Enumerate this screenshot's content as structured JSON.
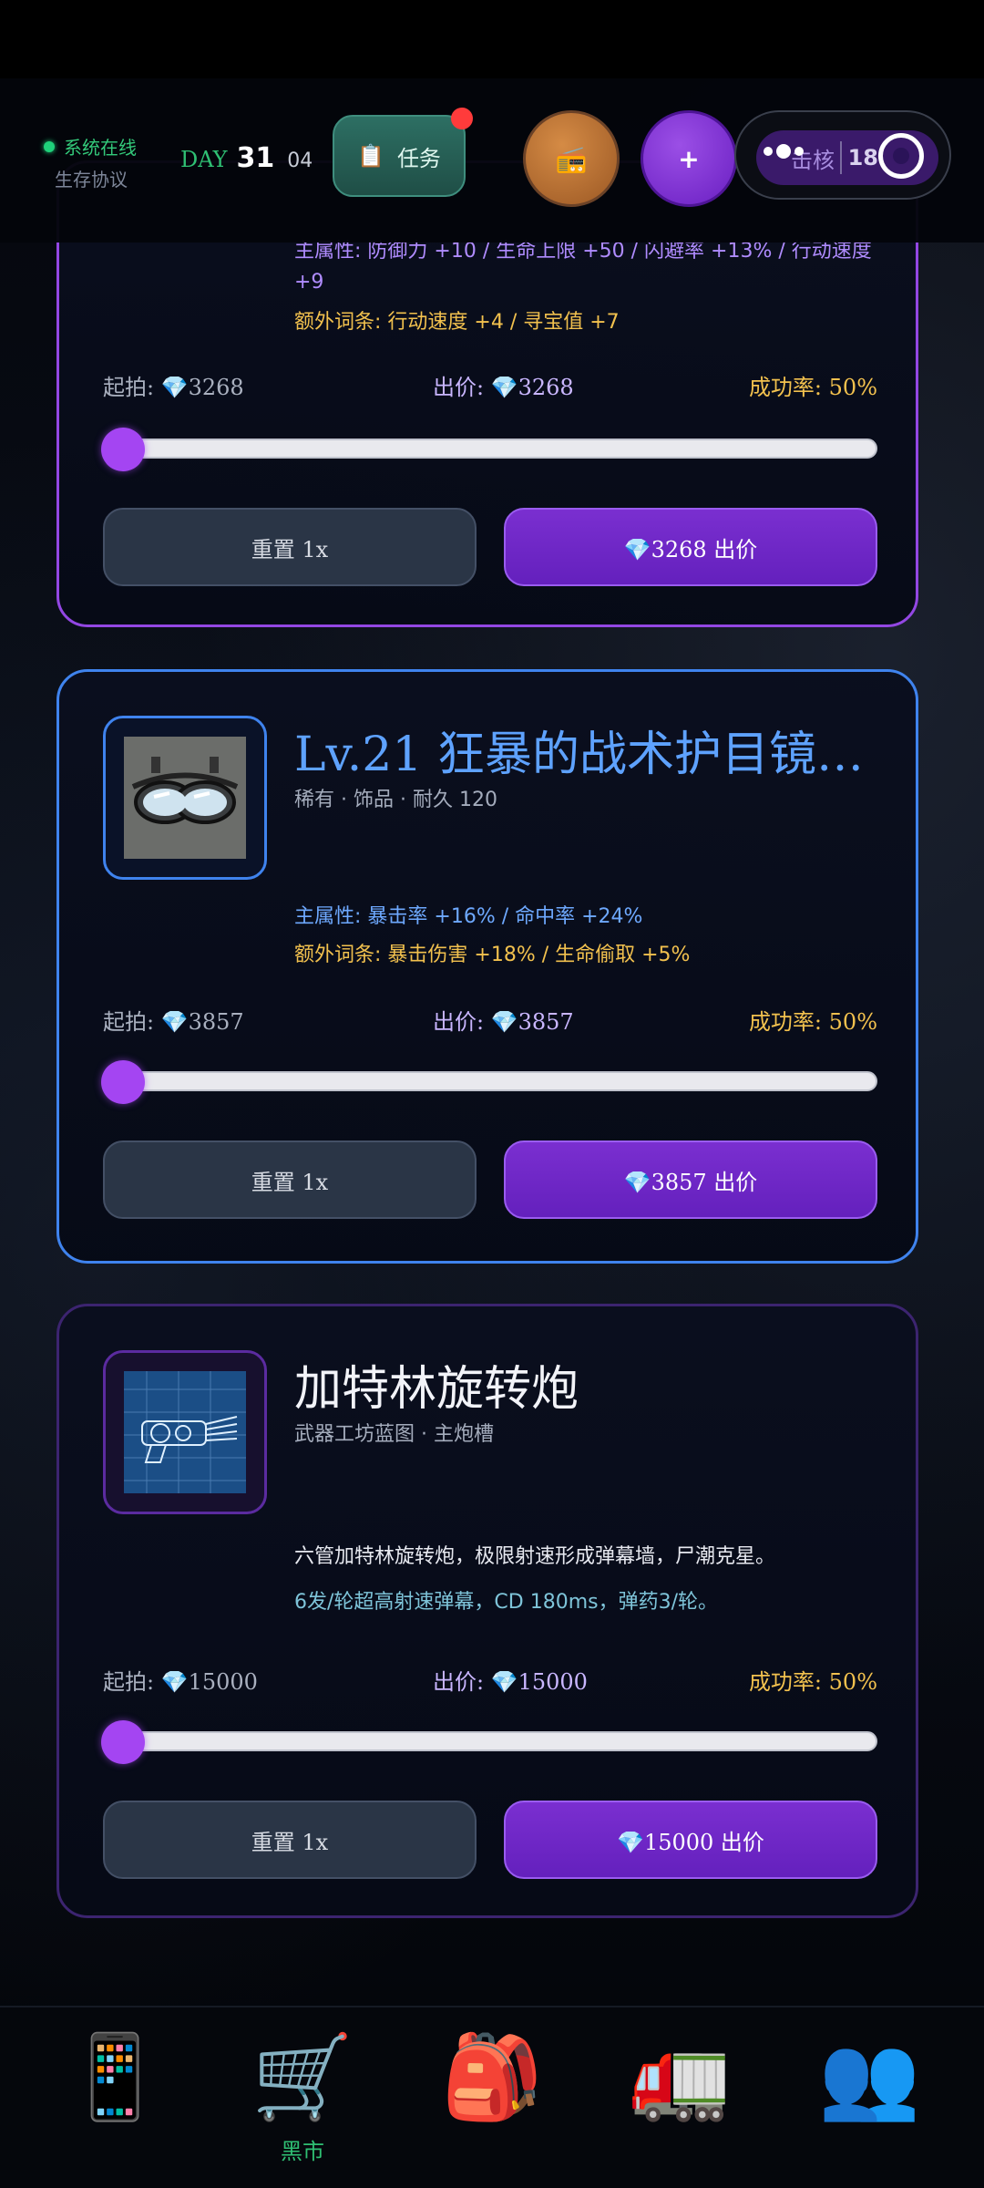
{
  "header": {
    "status_online": "系统在线",
    "status_protocol": "生存协议",
    "day_label": "DAY",
    "day_number": "31",
    "day_sub": "04",
    "task_label": "任务",
    "task_icon": "clipboard-icon",
    "radio_icon": "radio-icon",
    "plus_label": "+",
    "capsule_label": "击核",
    "capsule_number": "18"
  },
  "cards": [
    {
      "attr_main": "主属性: 防御力 +10 / 生命上限 +50 / 闪避率 +13% / 行动速度 +9",
      "attr_extra": "额外词条: 行动速度 +4 / 寻宝值 +7",
      "start_price": "起拍: 💎3268",
      "bid_price": "出价: 💎3268",
      "success_rate": "成功率: 50%",
      "slider_fraction": 0.0,
      "reset_label": "重置 1x",
      "bid_label": "💎3268 出价"
    },
    {
      "title": "Lv.21 狂暴的战术护目镜…",
      "subtitle": "稀有 · 饰品 · 耐久 120",
      "attr_main": "主属性: 暴击率 +16% / 命中率 +24%",
      "attr_extra": "额外词条: 暴击伤害 +18% / 生命偷取 +5%",
      "start_price": "起拍: 💎3857",
      "bid_price": "出价: 💎3857",
      "success_rate": "成功率: 50%",
      "slider_fraction": 0.0,
      "reset_label": "重置 1x",
      "bid_label": "💎3857 出价",
      "thumb_icon": "goggles-icon"
    },
    {
      "title": "加特林旋转炮",
      "subtitle": "武器工坊蓝图 · 主炮槽",
      "desc1": "六管加特林旋转炮，极限射速形成弹幕墙，尸潮克星。",
      "desc2": "6发/轮超高射速弹幕，CD 180ms，弹药3/轮。",
      "start_price": "起拍: 💎15000",
      "bid_price": "出价: 💎15000",
      "success_rate": "成功率: 50%",
      "slider_fraction": 0.0,
      "reset_label": "重置 1x",
      "bid_label": "💎15000 出价",
      "thumb_icon": "gatling-blueprint-icon"
    }
  ],
  "nav": {
    "items": [
      {
        "icon": "📱",
        "name": "phone-icon"
      },
      {
        "icon": "🛒",
        "name": "cart-icon",
        "label": "黑市"
      },
      {
        "icon": "🎒",
        "name": "backpack-icon"
      },
      {
        "icon": "🚛",
        "name": "truck-icon"
      },
      {
        "icon": "👥",
        "name": "people-icon"
      }
    ]
  }
}
